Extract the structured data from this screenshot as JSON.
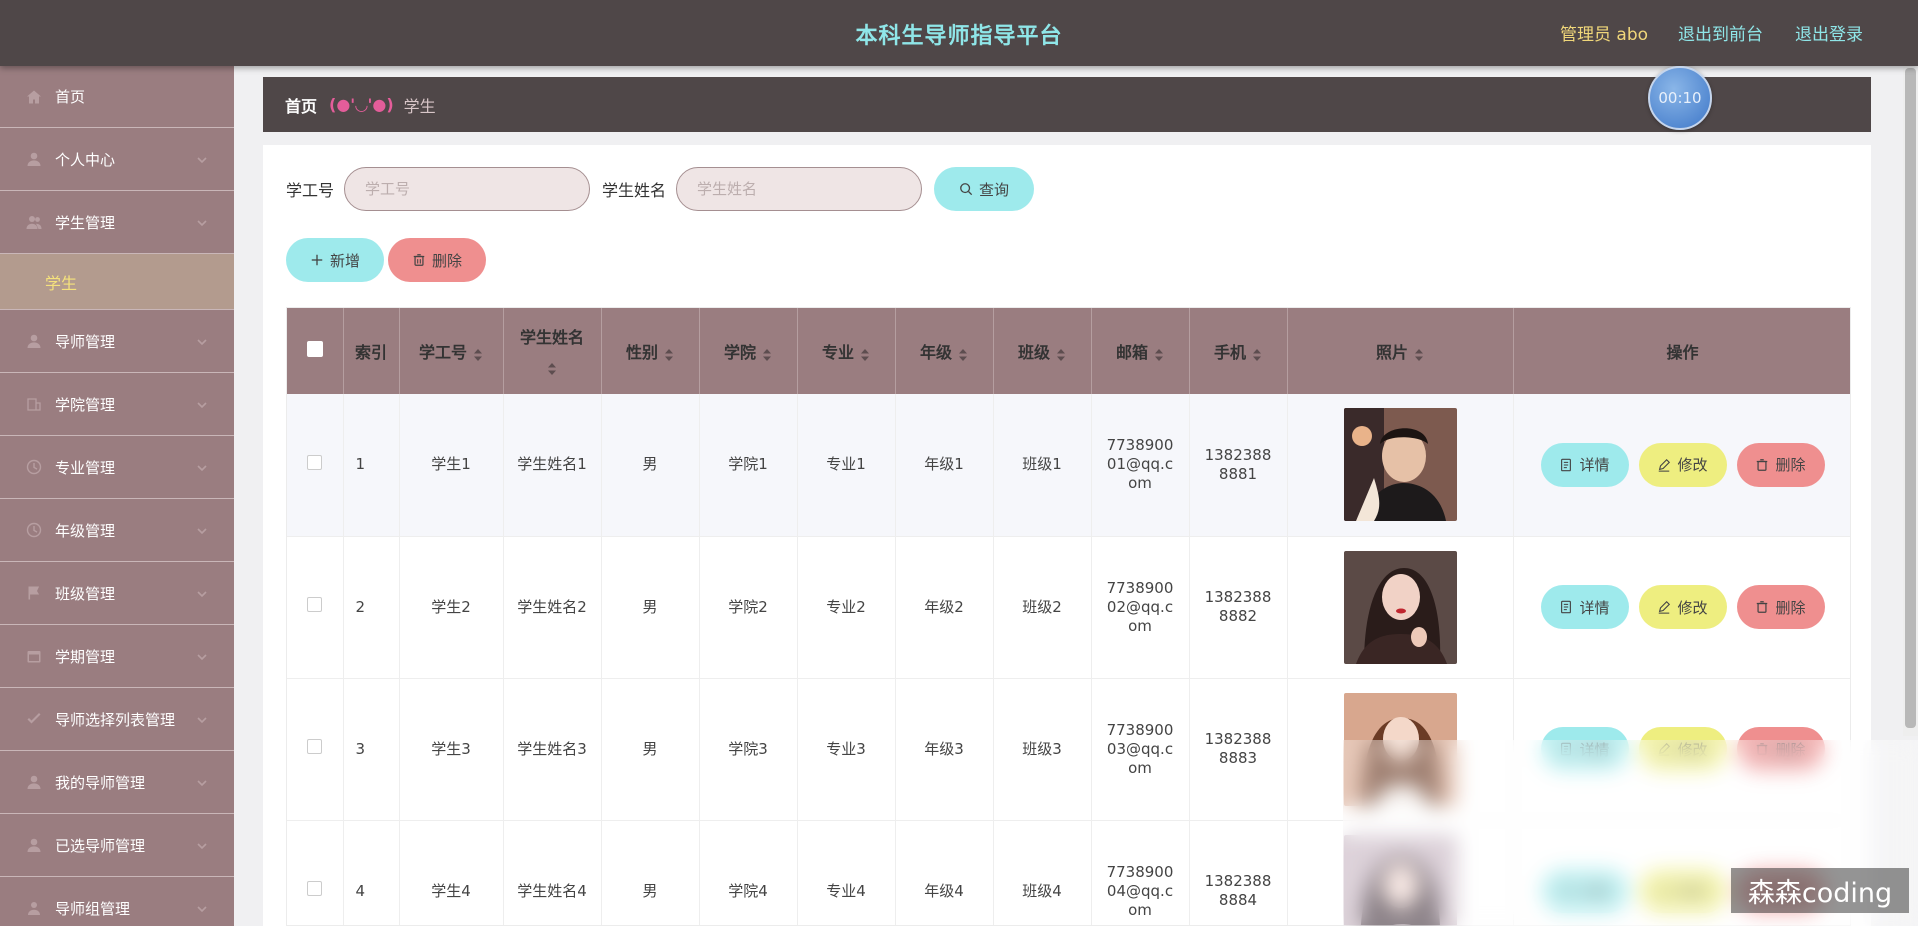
{
  "app": {
    "title": "本科生导师指导平台",
    "admin": "管理员 abo",
    "to_front": "退出到前台",
    "logout": "退出登录"
  },
  "sidebar": {
    "items": [
      {
        "label": "首页",
        "icon": "home-icon"
      },
      {
        "label": "个人中心",
        "icon": "user-icon"
      },
      {
        "label": "学生管理",
        "icon": "users-icon",
        "expanded": true,
        "sub": "学生"
      },
      {
        "label": "导师管理",
        "icon": "user-icon"
      },
      {
        "label": "学院管理",
        "icon": "building-icon"
      },
      {
        "label": "专业管理",
        "icon": "clock-icon"
      },
      {
        "label": "年级管理",
        "icon": "clock-icon"
      },
      {
        "label": "班级管理",
        "icon": "flag-icon"
      },
      {
        "label": "学期管理",
        "icon": "calendar-icon"
      },
      {
        "label": "导师选择列表管理",
        "icon": "list-icon"
      },
      {
        "label": "我的导师管理",
        "icon": "user-icon"
      },
      {
        "label": "已选导师管理",
        "icon": "user-icon"
      },
      {
        "label": "导师组管理",
        "icon": "group-icon"
      }
    ]
  },
  "breadcrumb": {
    "home": "首页",
    "emoticon": "(●'◡'●)",
    "current": "学生"
  },
  "timer": "00:10",
  "search": {
    "student_no_label": "学工号",
    "student_no_placeholder": "学工号",
    "student_name_label": "学生姓名",
    "student_name_placeholder": "学生姓名",
    "query_label": "查询"
  },
  "actions": {
    "add_label": "新增",
    "delete_label": "删除"
  },
  "table": {
    "headers": [
      "索引",
      "学工号",
      "学生姓名",
      "性别",
      "学院",
      "专业",
      "年级",
      "班级",
      "邮箱",
      "手机",
      "照片",
      "操作"
    ],
    "rows": [
      {
        "index": "1",
        "no": "学生1",
        "name": "学生姓名1",
        "gender": "男",
        "college": "学院1",
        "major": "专业1",
        "grade": "年级1",
        "class": "班级1",
        "email": "773890001@qq.com",
        "phone": "13823888881"
      },
      {
        "index": "2",
        "no": "学生2",
        "name": "学生姓名2",
        "gender": "男",
        "college": "学院2",
        "major": "专业2",
        "grade": "年级2",
        "class": "班级2",
        "email": "773890002@qq.com",
        "phone": "13823888882"
      },
      {
        "index": "3",
        "no": "学生3",
        "name": "学生姓名3",
        "gender": "男",
        "college": "学院3",
        "major": "专业3",
        "grade": "年级3",
        "class": "班级3",
        "email": "773890003@qq.com",
        "phone": "13823888883"
      },
      {
        "index": "4",
        "no": "学生4",
        "name": "学生姓名4",
        "gender": "男",
        "college": "学院4",
        "major": "专业4",
        "grade": "年级4",
        "class": "班级4",
        "email": "773890004@qq.com",
        "phone": "13823888884"
      }
    ],
    "ops": {
      "detail": "详情",
      "edit": "修改",
      "delete": "删除"
    }
  },
  "watermark": "森森coding",
  "colors": {
    "topbar": "#4f4748",
    "sidebar": "#9a7d80",
    "accent_cyan": "#9eeaec",
    "accent_red": "#ef8f8f",
    "accent_yellow": "#eeee80",
    "admin_yellow": "#f0d77a"
  }
}
